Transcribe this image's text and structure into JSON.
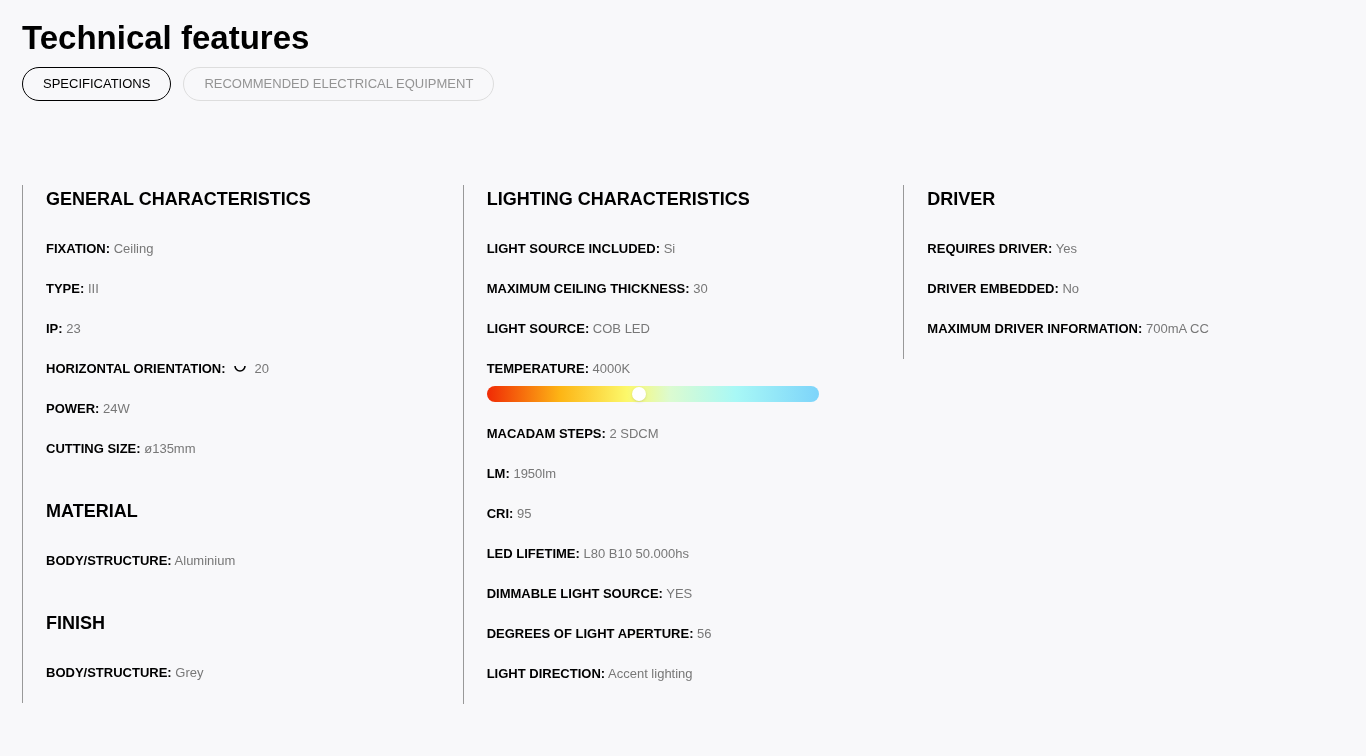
{
  "title": "Technical features",
  "tabs": [
    {
      "label": "SPECIFICATIONS",
      "selected": true
    },
    {
      "label": "RECOMMENDED ELECTRICAL EQUIPMENT",
      "selected": false
    }
  ],
  "columns": [
    {
      "sections": [
        {
          "heading": "GENERAL CHARACTERISTICS",
          "items": [
            {
              "kind": "text",
              "label": "FIXATION:",
              "value": "Ceiling"
            },
            {
              "kind": "text",
              "label": "TYPE:",
              "value": "III"
            },
            {
              "kind": "text",
              "label": "IP:",
              "value": "23"
            },
            {
              "kind": "rotation",
              "label": "HORIZONTAL ORIENTATION:",
              "value": "20"
            },
            {
              "kind": "text",
              "label": "POWER:",
              "value": "24W"
            },
            {
              "kind": "text",
              "label": "CUTTING SIZE:",
              "value": "ø135mm"
            }
          ]
        },
        {
          "heading": "MATERIAL",
          "items": [
            {
              "kind": "text",
              "label": "BODY/STRUCTURE:",
              "value": "Aluminium"
            }
          ]
        },
        {
          "heading": "FINISH",
          "items": [
            {
              "kind": "text",
              "label": "BODY/STRUCTURE:",
              "value": "Grey"
            }
          ]
        }
      ]
    },
    {
      "sections": [
        {
          "heading": "LIGHTING CHARACTERISTICS",
          "items": [
            {
              "kind": "text",
              "label": "LIGHT SOURCE INCLUDED:",
              "value": "Si"
            },
            {
              "kind": "text",
              "label": "MAXIMUM CEILING THICKNESS:",
              "value": "30"
            },
            {
              "kind": "text",
              "label": "LIGHT SOURCE:",
              "value": "COB LED"
            },
            {
              "kind": "slider",
              "label": "TEMPERATURE:",
              "value": "4000K",
              "level": 0.46
            },
            {
              "kind": "text",
              "label": "MACADAM STEPS:",
              "value": "2 SDCM"
            },
            {
              "kind": "text",
              "label": "LM:",
              "value": "1950lm"
            },
            {
              "kind": "text",
              "label": "CRI:",
              "value": "95"
            },
            {
              "kind": "text",
              "label": "LED LIFETIME:",
              "value": "L80 B10 50.000hs"
            },
            {
              "kind": "text",
              "label": "DIMMABLE LIGHT SOURCE:",
              "value": "YES"
            },
            {
              "kind": "text",
              "label": "DEGREES OF LIGHT APERTURE:",
              "value": "56"
            },
            {
              "kind": "text",
              "label": "LIGHT DIRECTION:",
              "value": "Accent lighting"
            }
          ]
        }
      ]
    },
    {
      "sections": [
        {
          "heading": "DRIVER",
          "items": [
            {
              "kind": "text",
              "label": "REQUIRES DRIVER:",
              "value": "Yes"
            },
            {
              "kind": "text",
              "label": "DRIVER EMBEDDED:",
              "value": "No"
            },
            {
              "kind": "text",
              "label": "MAXIMUM DRIVER INFORMATION:",
              "value": "700mA CC"
            }
          ]
        }
      ]
    }
  ]
}
